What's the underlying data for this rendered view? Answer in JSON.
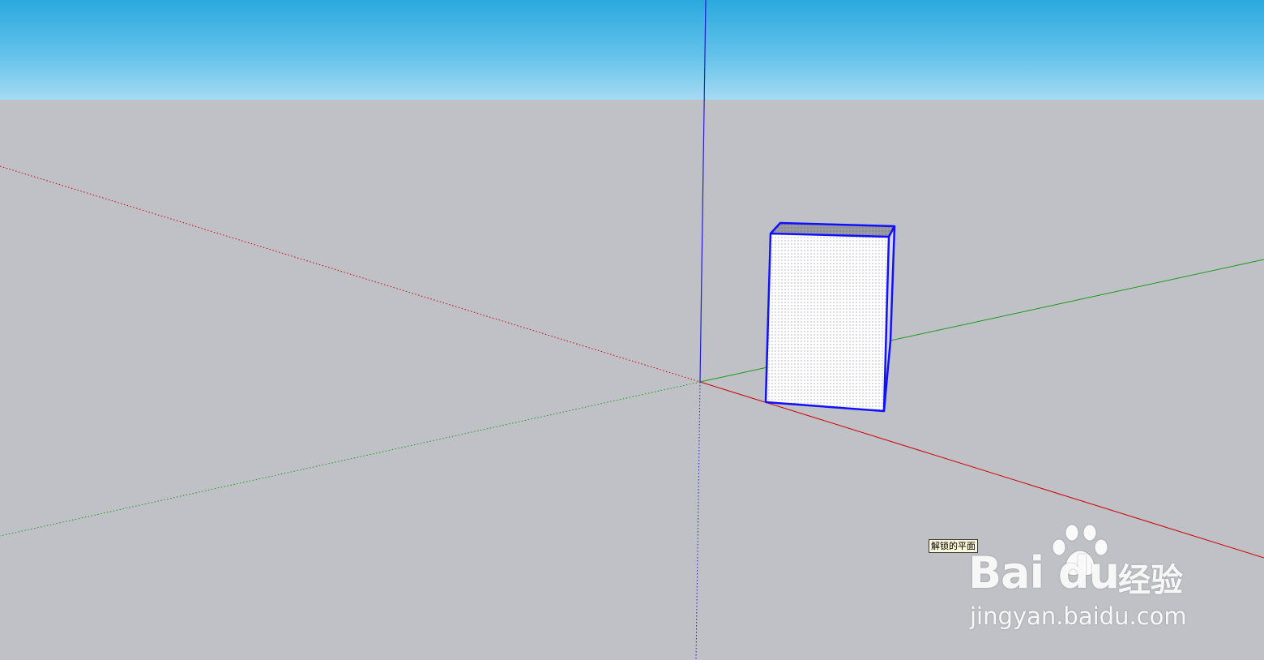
{
  "app": {
    "view": "3d-modeling-viewport"
  },
  "colors": {
    "sky_top": "#2aa9de",
    "sky_bottom": "#a5daf3",
    "ground": "#c0c1c6",
    "axis_red": "#cc0000",
    "axis_green": "#1a9a1a",
    "axis_blue": "#2020d0",
    "selection_edge": "#1010ff",
    "face_front": "#ffffff",
    "face_top": "#9a9aa2",
    "tooltip_bg": "#fbf8d9"
  },
  "tooltip": {
    "text": "解锁的平面"
  },
  "watermark": {
    "brand": "Bai du",
    "brand_suffix": "经验",
    "url": "jingyan.baidu.com",
    "icon": "paw-icon"
  }
}
